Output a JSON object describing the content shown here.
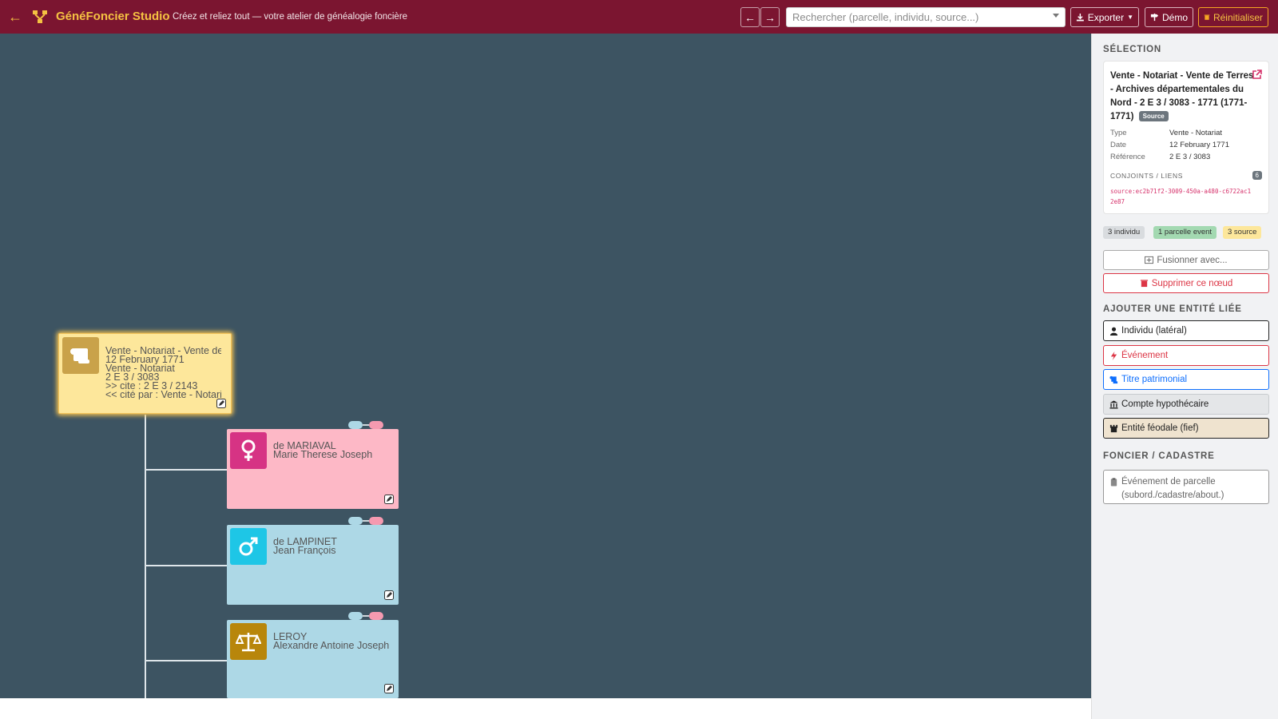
{
  "header": {
    "app_title": "GénéFoncier Studio",
    "subtitle": "Créez et reliez tout — votre atelier de généalogie foncière",
    "search_placeholder": "Rechercher (parcelle, individu, source...)",
    "export_label": "Exporter",
    "demo_label": "Démo",
    "reset_label": "Réinitialiser",
    "colors": {
      "bar": "#7b1530",
      "accent": "#f5c242"
    }
  },
  "canvas": {
    "source_node": {
      "lines": [
        "Vente - Notariat - Vente de Terres",
        "12 February 1771",
        "Vente - Notariat",
        "2 E 3 / 3083",
        ">> cite : 2 E 3 / 2143",
        "<< cité par : Vente - Notariat"
      ],
      "icon": "scroll-icon"
    },
    "persons": [
      {
        "line1": "de MARIAVAL",
        "line2": "Marie Therese Joseph",
        "icon": "female-icon"
      },
      {
        "line1": "de LAMPINET",
        "line2": "Jean François",
        "icon": "male-icon"
      },
      {
        "line1": "LEROY",
        "line2": "Alexandre Antoine Joseph",
        "icon": "scales-icon"
      }
    ]
  },
  "panel": {
    "selection_title": "SÉLECTION",
    "selected": {
      "title": "Vente - Notariat - Vente de Terres - Archives départementales du Nord - 2 E 3 / 3083 - 1771 (1771-1771)",
      "badge": "Source",
      "fields": [
        {
          "k": "Type",
          "v": "Vente - Notariat"
        },
        {
          "k": "Date",
          "v": "12 February 1771"
        },
        {
          "k": "Référence",
          "v": "2 E 3 / 3083"
        }
      ],
      "links_label": "CONJOINTS / LIENS",
      "links_count": "6",
      "source_id": "source:ec2b71f2-3009-450a-a480-c6722ac12e87"
    },
    "chips": [
      {
        "label": "3 individu",
        "color": "#d9dcdf"
      },
      {
        "label": "1 parcelle event",
        "color": "#a3d9b1"
      },
      {
        "label": "3 source",
        "color": "#fde79b"
      }
    ],
    "merge_label": "Fusionner avec...",
    "delete_label": "Supprimer ce nœud",
    "add_title": "AJOUTER UNE ENTITÉ LIÉE",
    "add_buttons": [
      {
        "label": "Individu (latéral)"
      },
      {
        "label": "Événement"
      },
      {
        "label": "Titre patrimonial"
      },
      {
        "label": "Compte hypothécaire"
      },
      {
        "label": "Entité féodale (fief)"
      }
    ],
    "cadastre_title": "FONCIER / CADASTRE",
    "cadastre_button": "Événement de parcelle (subord./cadastre/about.)"
  }
}
